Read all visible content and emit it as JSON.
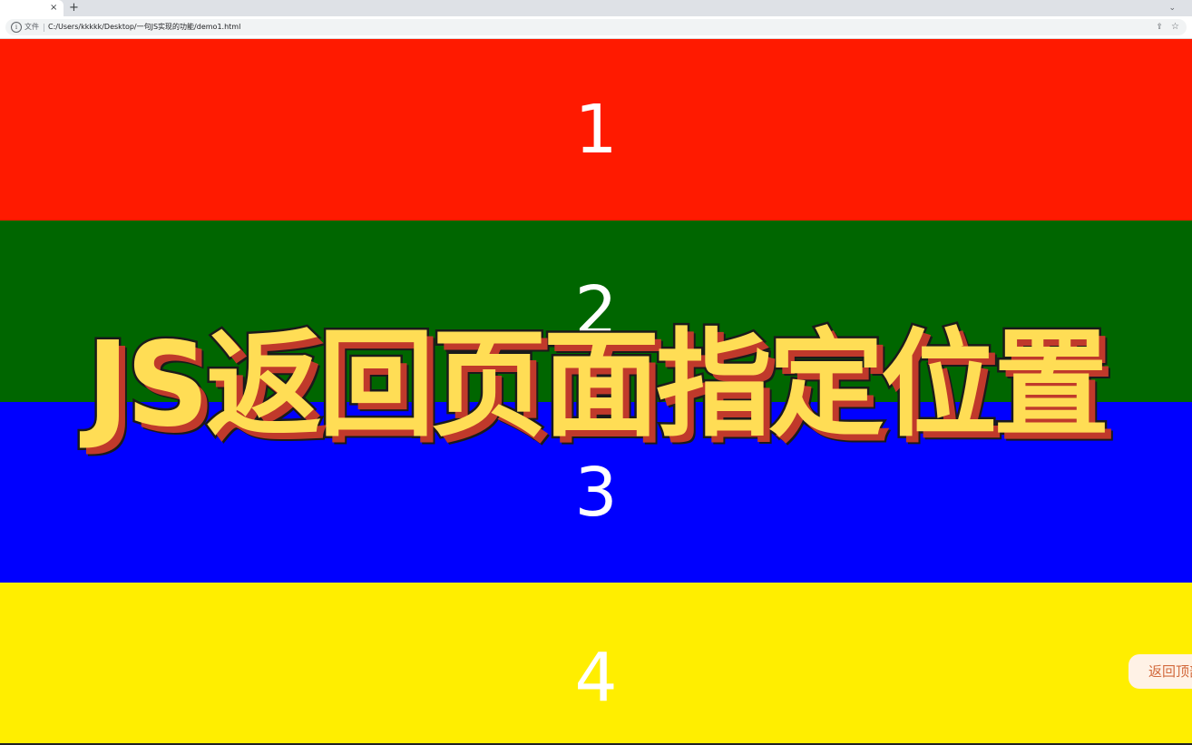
{
  "browser": {
    "tab_close": "×",
    "new_tab": "+",
    "tab_menu": "⌄",
    "site_label": "文件",
    "url": "C:/Users/kkkkk/Desktop/一句JS实现的功能/demo1.html"
  },
  "sections": [
    {
      "label": "1",
      "color": "#ff1a00"
    },
    {
      "label": "2",
      "color": "#006600"
    },
    {
      "label": "3",
      "color": "#0000ff"
    },
    {
      "label": "4",
      "color": "#ffee00"
    }
  ],
  "back_button": {
    "label": "返回顶部"
  },
  "overlay": {
    "caption": "JS返回页面指定位置"
  }
}
